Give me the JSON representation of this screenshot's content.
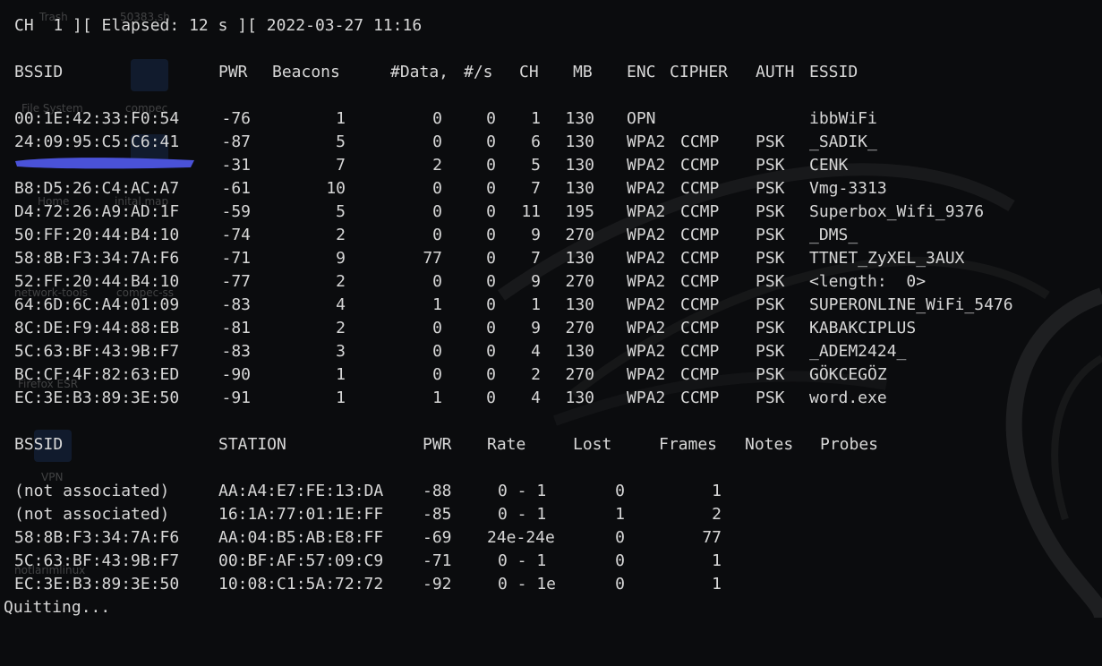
{
  "status_line": "CH  1 ][ Elapsed: 12 s ][ 2022-03-27 11:16",
  "desktop_labels": [
    "Trash",
    "50383.sh",
    "File System",
    "compec",
    "Home",
    "inital.map",
    "network-tools",
    "compec-ss",
    "Firefox ESR",
    "VPN",
    "notlarimlinux"
  ],
  "ap_table": {
    "headers": {
      "bssid": "BSSID",
      "pwr": "PWR",
      "beacons": "Beacons",
      "data": "#Data,",
      "rate": "#/s",
      "ch": "CH",
      "mb": "MB",
      "enc": "ENC",
      "cipher": "CIPHER",
      "auth": "AUTH",
      "essid": "ESSID"
    },
    "rows": [
      {
        "bssid": "00:1E:42:33:F0:54",
        "pwr": "-76",
        "beacons": "1",
        "data": "0",
        "rate": "0",
        "ch": "1",
        "mb": "130",
        "enc": "OPN",
        "cipher": "",
        "auth": "",
        "essid": "ibbWiFi"
      },
      {
        "bssid": "24:09:95:C5:C6:41",
        "pwr": "-87",
        "beacons": "5",
        "data": "0",
        "rate": "0",
        "ch": "6",
        "mb": "130",
        "enc": "WPA2",
        "cipher": "CCMP",
        "auth": "PSK",
        "essid": "_SADIK_"
      },
      {
        "bssid": "",
        "pwr": "-31",
        "beacons": "7",
        "data": "2",
        "rate": "0",
        "ch": "5",
        "mb": "130",
        "enc": "WPA2",
        "cipher": "CCMP",
        "auth": "PSK",
        "essid": "CENK"
      },
      {
        "bssid": "B8:D5:26:C4:AC:A7",
        "pwr": "-61",
        "beacons": "10",
        "data": "0",
        "rate": "0",
        "ch": "7",
        "mb": "130",
        "enc": "WPA2",
        "cipher": "CCMP",
        "auth": "PSK",
        "essid": "Vmg-3313"
      },
      {
        "bssid": "D4:72:26:A9:AD:1F",
        "pwr": "-59",
        "beacons": "5",
        "data": "0",
        "rate": "0",
        "ch": "11",
        "mb": "195",
        "enc": "WPA2",
        "cipher": "CCMP",
        "auth": "PSK",
        "essid": "Superbox_Wifi_9376"
      },
      {
        "bssid": "50:FF:20:44:B4:10",
        "pwr": "-74",
        "beacons": "2",
        "data": "0",
        "rate": "0",
        "ch": "9",
        "mb": "270",
        "enc": "WPA2",
        "cipher": "CCMP",
        "auth": "PSK",
        "essid": "_DMS_"
      },
      {
        "bssid": "58:8B:F3:34:7A:F6",
        "pwr": "-71",
        "beacons": "9",
        "data": "77",
        "rate": "0",
        "ch": "7",
        "mb": "130",
        "enc": "WPA2",
        "cipher": "CCMP",
        "auth": "PSK",
        "essid": "TTNET_ZyXEL_3AUX"
      },
      {
        "bssid": "52:FF:20:44:B4:10",
        "pwr": "-77",
        "beacons": "2",
        "data": "0",
        "rate": "0",
        "ch": "9",
        "mb": "270",
        "enc": "WPA2",
        "cipher": "CCMP",
        "auth": "PSK",
        "essid": "<length:  0>"
      },
      {
        "bssid": "64:6D:6C:A4:01:09",
        "pwr": "-83",
        "beacons": "4",
        "data": "1",
        "rate": "0",
        "ch": "1",
        "mb": "130",
        "enc": "WPA2",
        "cipher": "CCMP",
        "auth": "PSK",
        "essid": "SUPERONLINE_WiFi_5476"
      },
      {
        "bssid": "8C:DE:F9:44:88:EB",
        "pwr": "-81",
        "beacons": "2",
        "data": "0",
        "rate": "0",
        "ch": "9",
        "mb": "270",
        "enc": "WPA2",
        "cipher": "CCMP",
        "auth": "PSK",
        "essid": "KABAKCIPLUS"
      },
      {
        "bssid": "5C:63:BF:43:9B:F7",
        "pwr": "-83",
        "beacons": "3",
        "data": "0",
        "rate": "0",
        "ch": "4",
        "mb": "130",
        "enc": "WPA2",
        "cipher": "CCMP",
        "auth": "PSK",
        "essid": "_ADEM2424_"
      },
      {
        "bssid": "BC:CF:4F:82:63:ED",
        "pwr": "-90",
        "beacons": "1",
        "data": "0",
        "rate": "0",
        "ch": "2",
        "mb": "270",
        "enc": "WPA2",
        "cipher": "CCMP",
        "auth": "PSK",
        "essid": "GÖKCEGÖZ"
      },
      {
        "bssid": "EC:3E:B3:89:3E:50",
        "pwr": "-91",
        "beacons": "1",
        "data": "1",
        "rate": "0",
        "ch": "4",
        "mb": "130",
        "enc": "WPA2",
        "cipher": "CCMP",
        "auth": "PSK",
        "essid": "word.exe"
      }
    ]
  },
  "station_table": {
    "headers": {
      "bssid": "BSSID",
      "station": "STATION",
      "pwr": "PWR",
      "rate": "Rate",
      "lost": "Lost",
      "frames": "Frames",
      "notes": "Notes",
      "probes": "Probes"
    },
    "rows": [
      {
        "bssid": "(not associated)",
        "station": "AA:A4:E7:FE:13:DA",
        "pwr": "-88",
        "rate": "0 - 1",
        "lost": "0",
        "frames": "1"
      },
      {
        "bssid": "(not associated)",
        "station": "16:1A:77:01:1E:FF",
        "pwr": "-85",
        "rate": "0 - 1",
        "lost": "1",
        "frames": "2"
      },
      {
        "bssid": "58:8B:F3:34:7A:F6",
        "station": "AA:04:B5:AB:E8:FF",
        "pwr": "-69",
        "rate": "24e-24e",
        "lost": "0",
        "frames": "77"
      },
      {
        "bssid": "5C:63:BF:43:9B:F7",
        "station": "00:BF:AF:57:09:C9",
        "pwr": "-71",
        "rate": "0 - 1",
        "lost": "0",
        "frames": "1"
      },
      {
        "bssid": "EC:3E:B3:89:3E:50",
        "station": "10:08:C1:5A:72:72",
        "pwr": "-92",
        "rate": "0 - 1e",
        "lost": "0",
        "frames": "1"
      }
    ]
  },
  "footer": "Quitting...",
  "colors": {
    "background": "#0b0c0e",
    "text": "#d7d7d7",
    "redaction": "#4a52d8"
  }
}
